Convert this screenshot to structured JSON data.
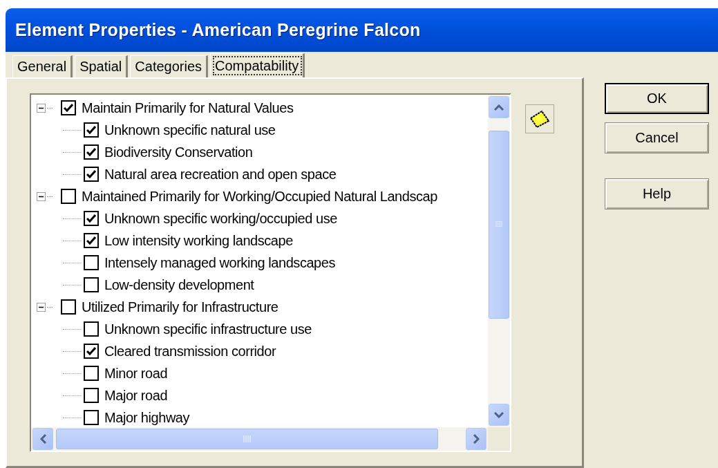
{
  "window": {
    "title": "Element Properties - American Peregrine Falcon"
  },
  "tabs": [
    {
      "label": "General",
      "selected": false
    },
    {
      "label": "Spatial",
      "selected": false
    },
    {
      "label": "Categories",
      "selected": false
    },
    {
      "label": "Compatability",
      "selected": true
    }
  ],
  "tree": [
    {
      "label": "Maintain Primarily for Natural Values",
      "checked": true,
      "expanded": true,
      "children": [
        {
          "label": "Unknown specific natural use",
          "checked": true
        },
        {
          "label": "Biodiversity Conservation",
          "checked": true
        },
        {
          "label": "Natural area recreation and open space",
          "checked": true
        }
      ]
    },
    {
      "label": "Maintained Primarily for Working/Occupied Natural Landscap",
      "checked": false,
      "expanded": true,
      "children": [
        {
          "label": "Unknown specific working/occupied use",
          "checked": true
        },
        {
          "label": "Low intensity working landscape",
          "checked": true
        },
        {
          "label": "Intensely managed working landscapes",
          "checked": false
        },
        {
          "label": "Low-density development",
          "checked": false
        }
      ]
    },
    {
      "label": "Utilized Primarily for Infrastructure",
      "checked": false,
      "expanded": true,
      "children": [
        {
          "label": "Unknown specific infrastructure use",
          "checked": false
        },
        {
          "label": "Cleared transmission corridor",
          "checked": true
        },
        {
          "label": "Minor road",
          "checked": false
        },
        {
          "label": "Major road",
          "checked": false
        },
        {
          "label": "Major highway",
          "checked": false
        }
      ]
    }
  ],
  "buttons": [
    {
      "label": "OK",
      "default": true
    },
    {
      "label": "Cancel",
      "default": false
    },
    {
      "label": "Help",
      "default": false
    }
  ]
}
